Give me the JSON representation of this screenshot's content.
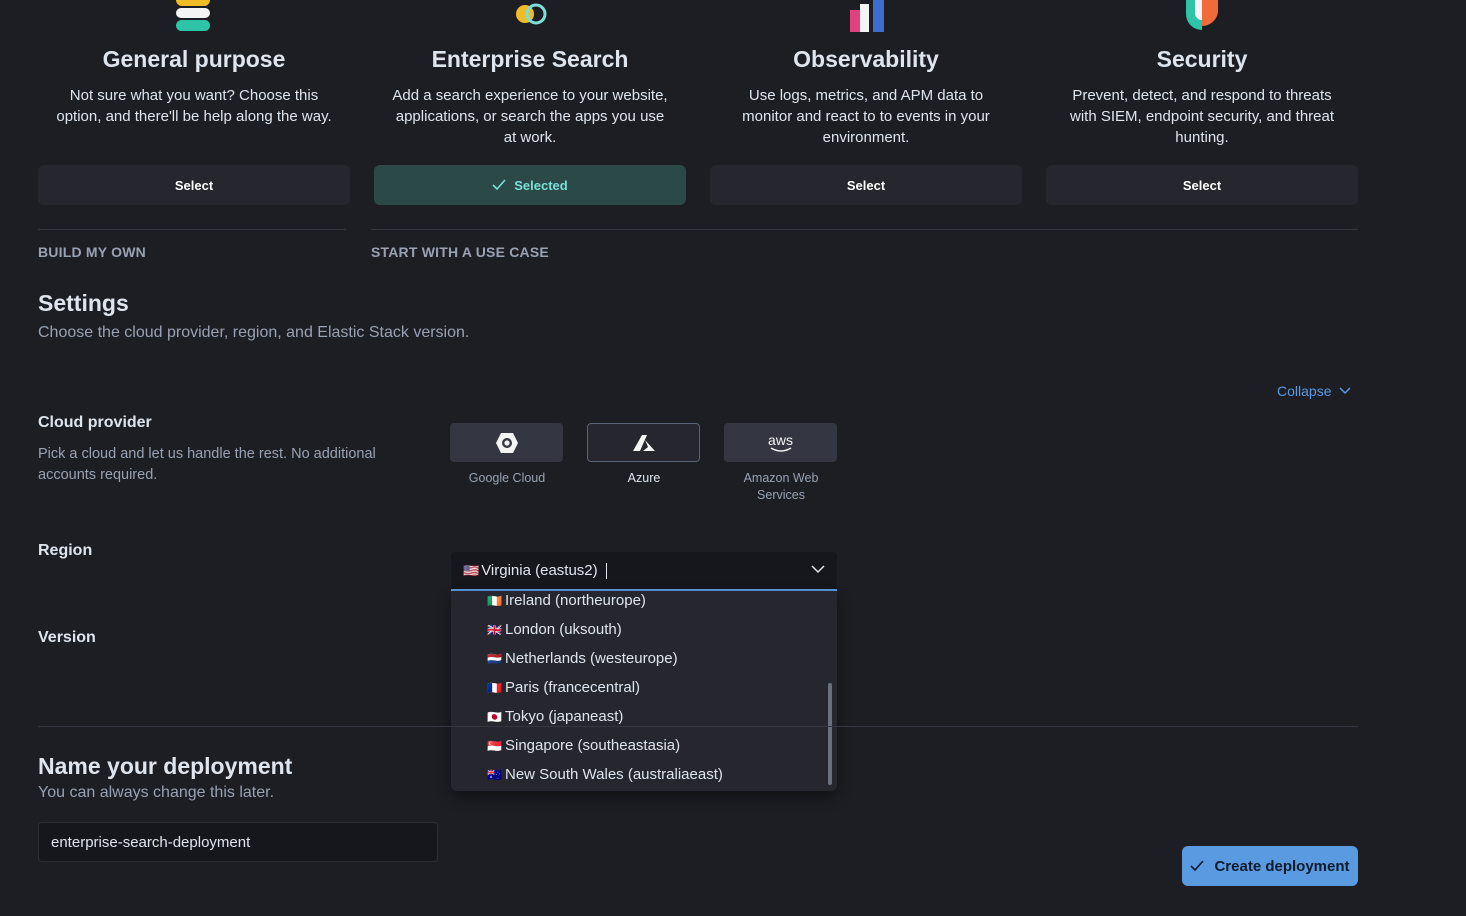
{
  "use_cases": [
    {
      "title": "General purpose",
      "description": "Not sure what you want? Choose this option, and there'll be help along the way.",
      "button": "Select",
      "icon": "general-purpose-logo"
    },
    {
      "title": "Enterprise Search",
      "description": "Add a search experience to your website, applications, or search the apps you use at work.",
      "button": "Selected",
      "icon": "enterprise-search-logo"
    },
    {
      "title": "Observability",
      "description": "Use logs, metrics, and APM data to monitor and react to to events in your environment.",
      "button": "Select",
      "icon": "observability-logo"
    },
    {
      "title": "Security",
      "description": "Prevent, detect, and respond to threats with SIEM, endpoint security, and threat hunting.",
      "button": "Select",
      "icon": "security-logo"
    }
  ],
  "tabs": {
    "build_my_own": "BUILD MY OWN",
    "start_with_use_case": "START WITH A USE CASE"
  },
  "settings": {
    "title": "Settings",
    "subtitle": "Choose the cloud provider, region, and Elastic Stack version.",
    "collapse": "Collapse",
    "cloud_provider": {
      "label": "Cloud provider",
      "help": "Pick a cloud and let us handle the rest. No additional accounts required.",
      "options": [
        {
          "label": "Google Cloud",
          "icon": "google-cloud-icon"
        },
        {
          "label": "Azure",
          "icon": "azure-icon",
          "selected": true
        },
        {
          "label": "Amazon Web Services",
          "icon": "aws-icon",
          "logo_text": "aws"
        }
      ]
    },
    "region": {
      "label": "Region",
      "value": "Virginia (eastus2)",
      "value_flag": "🇺🇸",
      "options": [
        {
          "flag": "🇮🇪",
          "label": "Ireland (northeurope)"
        },
        {
          "flag": "🇬🇧",
          "label": "London (uksouth)"
        },
        {
          "flag": "🇳🇱",
          "label": "Netherlands (westeurope)"
        },
        {
          "flag": "🇫🇷",
          "label": "Paris (francecentral)"
        },
        {
          "flag": "🇯🇵",
          "label": "Tokyo (japaneast)"
        },
        {
          "flag": "🇸🇬",
          "label": "Singapore (southeastasia)"
        },
        {
          "flag": "🇦🇺",
          "label": "New South Wales (australiaeast)"
        }
      ]
    },
    "version": {
      "label": "Version"
    }
  },
  "deployment": {
    "title": "Name your deployment",
    "subtitle": "You can always change this later.",
    "name_value": "enterprise-search-deployment",
    "create_button": "Create deployment"
  },
  "colors": {
    "accent": "#5a9ae0",
    "selected_bg": "#2b4a47",
    "selected_text": "#7dded8",
    "background": "#1d1e24"
  }
}
